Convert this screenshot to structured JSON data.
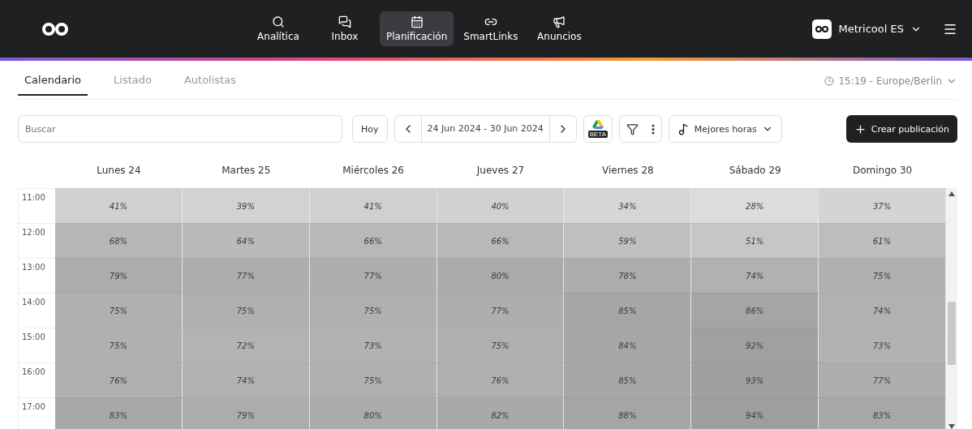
{
  "nav": [
    {
      "label": "Analítica",
      "selected": false
    },
    {
      "label": "Inbox",
      "selected": false
    },
    {
      "label": "Planificación",
      "selected": true
    },
    {
      "label": "SmartLinks",
      "selected": false
    },
    {
      "label": "Anuncios",
      "selected": false
    }
  ],
  "account": {
    "name": "Metricool ES"
  },
  "tabs": [
    {
      "label": "Calendario",
      "selected": true
    },
    {
      "label": "Listado",
      "selected": false
    },
    {
      "label": "Autolistas",
      "selected": false
    }
  ],
  "timezone": "15:19 - Europe/Berlin",
  "search": {
    "placeholder": "Buscar"
  },
  "today_button": "Hoy",
  "date_range": "24 Jun 2024 - 30 Jun 2024",
  "beta_badge": "BETA",
  "best_hours": "Mejores horas",
  "create_button": "Crear publicación",
  "days": [
    "Lunes 24",
    "Martes 25",
    "Miércoles 26",
    "Jueves 27",
    "Viernes 28",
    "Sábado 29",
    "Domingo 30"
  ],
  "rows": [
    {
      "time": "11:00",
      "cells": [
        {
          "text": "41%",
          "color": "#d0d0d0"
        },
        {
          "text": "39%",
          "color": "#d2d2d2"
        },
        {
          "text": "41%",
          "color": "#d0d0d0"
        },
        {
          "text": "40%",
          "color": "#d1d1d1"
        },
        {
          "text": "34%",
          "color": "#d6d6d6"
        },
        {
          "text": "28%",
          "color": "#dcdcdc"
        },
        {
          "text": "37%",
          "color": "#d4d4d4"
        }
      ]
    },
    {
      "time": "12:00",
      "cells": [
        {
          "text": "68%",
          "color": "#b6b6b6"
        },
        {
          "text": "64%",
          "color": "#bababa"
        },
        {
          "text": "66%",
          "color": "#b8b8b8"
        },
        {
          "text": "66%",
          "color": "#b8b8b8"
        },
        {
          "text": "59%",
          "color": "#bfbfbf"
        },
        {
          "text": "51%",
          "color": "#c6c6c6"
        },
        {
          "text": "61%",
          "color": "#bdbdbd"
        }
      ]
    },
    {
      "time": "13:00",
      "cells": [
        {
          "text": "79%",
          "color": "#acacac"
        },
        {
          "text": "77%",
          "color": "#aeaeae"
        },
        {
          "text": "77%",
          "color": "#aeaeae"
        },
        {
          "text": "80%",
          "color": "#ababab"
        },
        {
          "text": "78%",
          "color": "#adadad"
        },
        {
          "text": "74%",
          "color": "#b1b1b1"
        },
        {
          "text": "75%",
          "color": "#b0b0b0"
        }
      ]
    },
    {
      "time": "14:00",
      "cells": [
        {
          "text": "75%",
          "color": "#b0b0b0"
        },
        {
          "text": "75%",
          "color": "#b0b0b0"
        },
        {
          "text": "75%",
          "color": "#b0b0b0"
        },
        {
          "text": "77%",
          "color": "#aeaeae"
        },
        {
          "text": "85%",
          "color": "#a6a6a6"
        },
        {
          "text": "86%",
          "color": "#a5a5a5"
        },
        {
          "text": "74%",
          "color": "#b1b1b1"
        }
      ]
    },
    {
      "time": "15:00",
      "cells": [
        {
          "text": "75%",
          "color": "#b0b0b0"
        },
        {
          "text": "72%",
          "color": "#b3b3b3"
        },
        {
          "text": "73%",
          "color": "#b2b2b2"
        },
        {
          "text": "75%",
          "color": "#b0b0b0"
        },
        {
          "text": "84%",
          "color": "#a7a7a7"
        },
        {
          "text": "92%",
          "color": "#a0a0a0"
        },
        {
          "text": "73%",
          "color": "#b2b2b2"
        }
      ]
    },
    {
      "time": "16:00",
      "cells": [
        {
          "text": "76%",
          "color": "#afafaf"
        },
        {
          "text": "74%",
          "color": "#b1b1b1"
        },
        {
          "text": "75%",
          "color": "#b0b0b0"
        },
        {
          "text": "76%",
          "color": "#afafaf"
        },
        {
          "text": "85%",
          "color": "#a6a6a6"
        },
        {
          "text": "93%",
          "color": "#9f9f9f"
        },
        {
          "text": "77%",
          "color": "#aeaeae"
        }
      ]
    },
    {
      "time": "17:00",
      "cells": [
        {
          "text": "83%",
          "color": "#a8a8a8"
        },
        {
          "text": "79%",
          "color": "#acacac"
        },
        {
          "text": "80%",
          "color": "#ababab"
        },
        {
          "text": "82%",
          "color": "#a9a9a9"
        },
        {
          "text": "88%",
          "color": "#a5a5a5"
        },
        {
          "text": "94%",
          "color": "#9e9e9e"
        },
        {
          "text": "83%",
          "color": "#a8a8a8"
        }
      ]
    }
  ]
}
